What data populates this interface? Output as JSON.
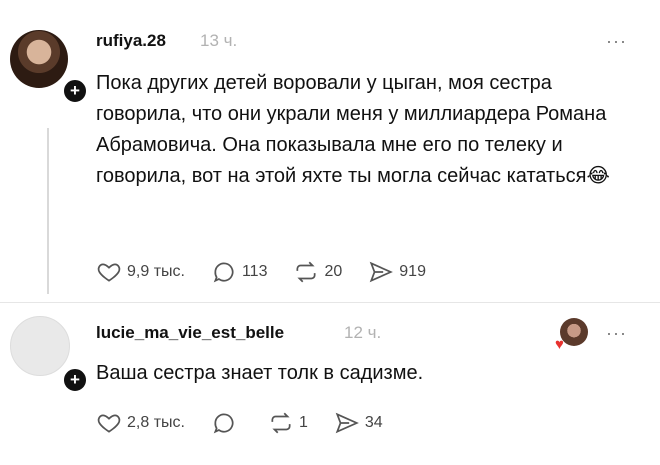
{
  "posts": [
    {
      "username": "rufiya.28",
      "time": "13 ч.",
      "more": "···",
      "text": "Пока других детей воровали у цыган, моя сестра говорила, что они украли меня у миллиардера Романа Абрамовича. Она показывала мне его по телеку и говорила, вот на этой яхте ты могла сейчас кататься😂",
      "likes": "9,9 тыс.",
      "replies": "113",
      "reposts": "20",
      "shares": "919"
    },
    {
      "username": "lucie_ma_vie_est_belle",
      "time": "12 ч.",
      "more": "···",
      "text": "Ваша сестра знает толк в садизме.",
      "likes": "2,8 тыс.",
      "replies": "",
      "reposts": "1",
      "shares": "34"
    }
  ],
  "icons": {
    "follow": "plus-icon",
    "like": "heart-icon",
    "reply": "comment-icon",
    "repost": "repost-icon",
    "share": "share-icon",
    "reaction": "heart-icon"
  },
  "colors": {
    "text": "#111111",
    "meta": "#b2b2b2",
    "heart": "#e8322f"
  }
}
